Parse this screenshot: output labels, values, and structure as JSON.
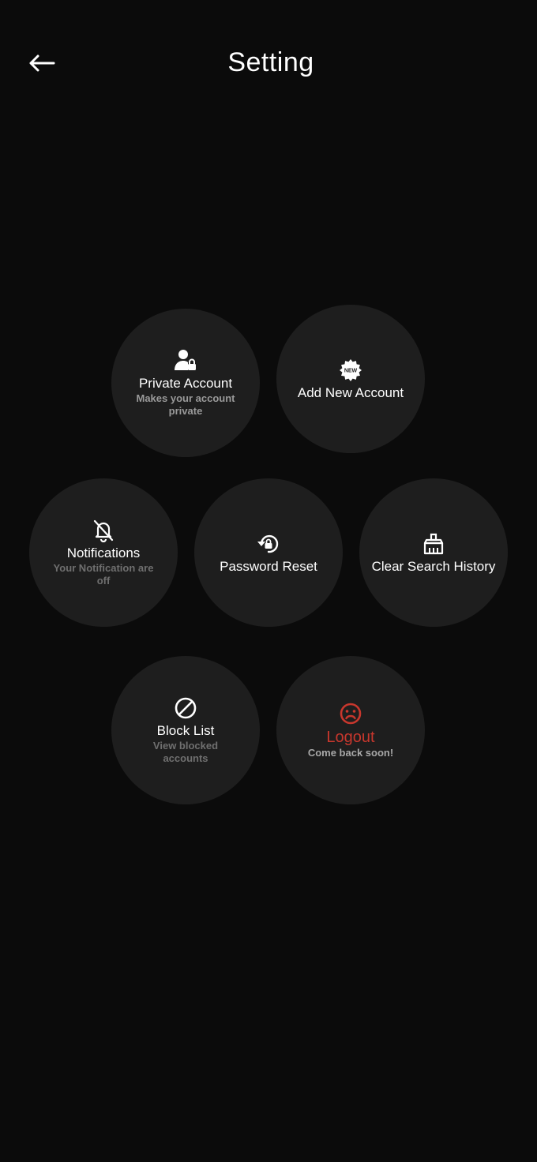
{
  "header": {
    "title": "Setting",
    "back_icon": "arrow-left-icon"
  },
  "accent_colors": {
    "background": "#0b0b0b",
    "tile": "#1e1e1e",
    "logout": "#c8372d",
    "subtext": "#6f6f6f"
  },
  "settings": {
    "private_account": {
      "label": "Private Account",
      "sub": "Makes your account private",
      "icon": "user-lock-icon"
    },
    "add_new_account": {
      "label": "Add New Account",
      "icon": "new-badge-icon",
      "badge_text": "NEW"
    },
    "notifications": {
      "label": "Notifications",
      "sub": "Your Notification are off",
      "icon": "bell-off-icon"
    },
    "password_reset": {
      "label": "Password Reset",
      "icon": "lock-reset-icon"
    },
    "clear_search_history": {
      "label": "Clear Search History",
      "icon": "broom-icon"
    },
    "block_list": {
      "label": "Block List",
      "sub": "View blocked accounts",
      "icon": "block-icon"
    },
    "logout": {
      "label": "Logout",
      "sub": "Come back soon!",
      "icon": "sad-face-icon"
    }
  }
}
